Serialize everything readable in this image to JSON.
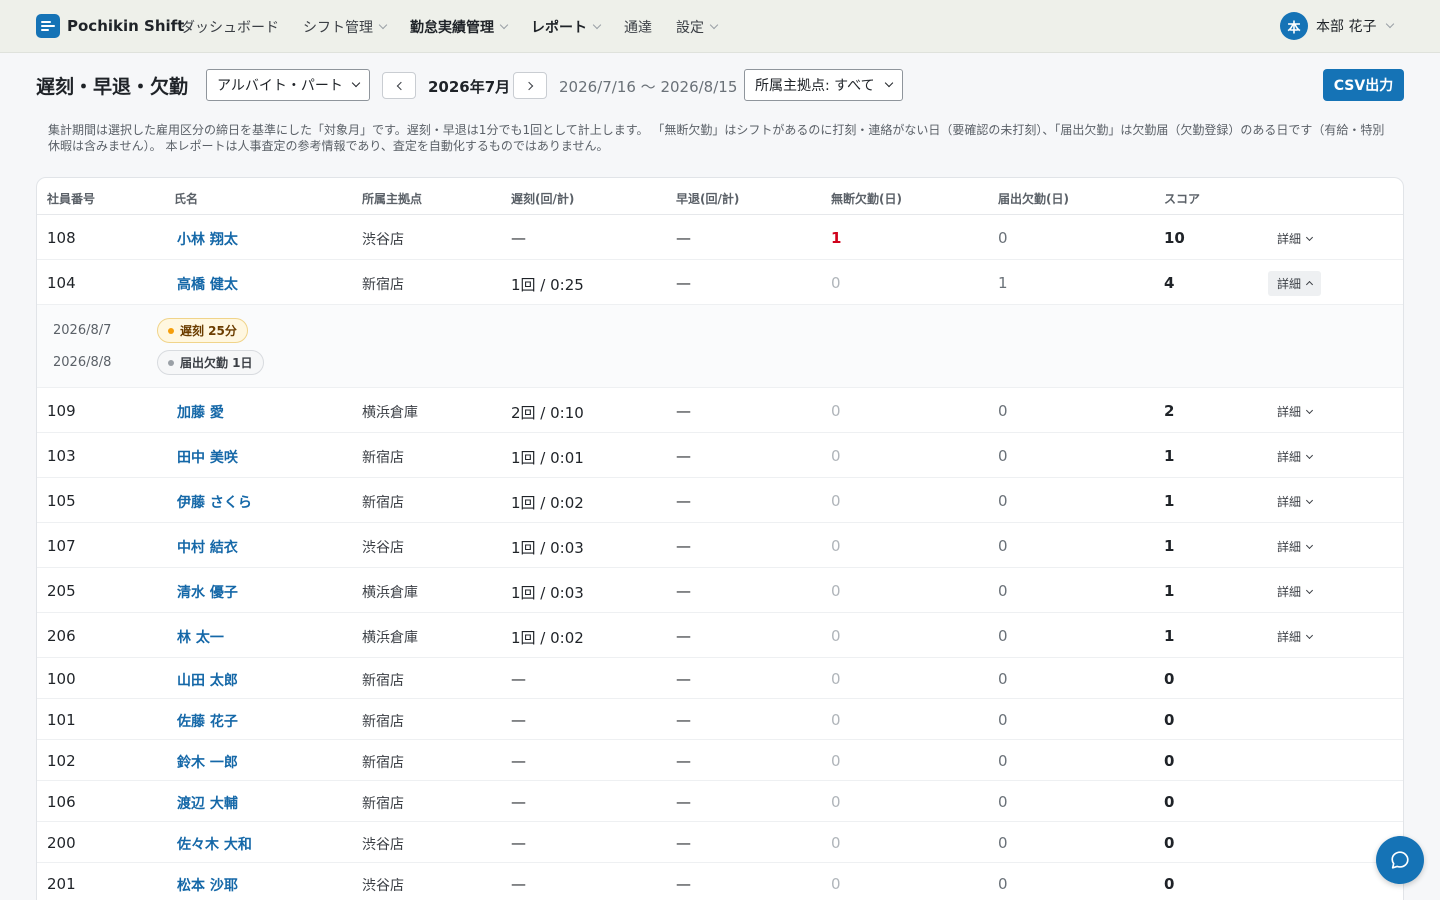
{
  "app": {
    "brand": "Pochikin Shift"
  },
  "nav": [
    {
      "label": "ダッシュボード",
      "dropdown": false,
      "bold": false
    },
    {
      "label": "シフト管理",
      "dropdown": true,
      "bold": false
    },
    {
      "label": "勤怠実績管理",
      "dropdown": true,
      "bold": true
    },
    {
      "label": "レポート",
      "dropdown": true,
      "bold": true
    },
    {
      "label": "通達",
      "dropdown": false,
      "bold": false
    },
    {
      "label": "設定",
      "dropdown": true,
      "bold": false
    }
  ],
  "user": {
    "initial": "本",
    "name": "本部 花子"
  },
  "page": {
    "title": "遅刻・早退・欠勤",
    "employment_type": "アルバイト・パート",
    "month": "2026年7月",
    "range": "2026/7/16 〜 2026/8/15",
    "base_filter": "所属主拠点: すべて",
    "csv_label": "CSV出力",
    "note": "集計期間は選択した雇用区分の締日を基準にした「対象月」です。遅刻・早退は1分でも1回として計上します。 「無断欠勤」はシフトがあるのに打刻・連絡がない日（要確認の未打刻）、「届出欠勤」は欠勤届（欠勤登録）のある日です（有給・特別休暇は含みません）。 本レポートは人事査定の参考情報であり、査定を自動化するものではありません。"
  },
  "table": {
    "headers": [
      "社員番号",
      "氏名",
      "所属主拠点",
      "遅刻(回/計)",
      "早退(回/計)",
      "無断欠勤(日)",
      "届出欠勤(日)",
      "スコア"
    ],
    "detail_label": "詳細",
    "rows": [
      {
        "id": "108",
        "name": "小林 翔太",
        "base": "渋谷店",
        "late": "—",
        "early": "—",
        "absent": "1",
        "notified": "0",
        "score": "10",
        "detail": true,
        "expanded": false,
        "alert": true
      },
      {
        "id": "104",
        "name": "高橋 健太",
        "base": "新宿店",
        "late": "1回 / 0:25",
        "early": "—",
        "absent": "0",
        "notified": "1",
        "score": "4",
        "detail": true,
        "expanded": true,
        "alert": false,
        "events": [
          {
            "date": "2026/8/7",
            "label": "遅刻 25分",
            "kind": "late"
          },
          {
            "date": "2026/8/8",
            "label": "届出欠勤 1日",
            "kind": "abs"
          }
        ]
      },
      {
        "id": "109",
        "name": "加藤 愛",
        "base": "横浜倉庫",
        "late": "2回 / 0:10",
        "early": "—",
        "absent": "0",
        "notified": "0",
        "score": "2",
        "detail": true,
        "expanded": false,
        "alert": false
      },
      {
        "id": "103",
        "name": "田中 美咲",
        "base": "新宿店",
        "late": "1回 / 0:01",
        "early": "—",
        "absent": "0",
        "notified": "0",
        "score": "1",
        "detail": true,
        "expanded": false,
        "alert": false
      },
      {
        "id": "105",
        "name": "伊藤 さくら",
        "base": "新宿店",
        "late": "1回 / 0:02",
        "early": "—",
        "absent": "0",
        "notified": "0",
        "score": "1",
        "detail": true,
        "expanded": false,
        "alert": false
      },
      {
        "id": "107",
        "name": "中村 結衣",
        "base": "渋谷店",
        "late": "1回 / 0:03",
        "early": "—",
        "absent": "0",
        "notified": "0",
        "score": "1",
        "detail": true,
        "expanded": false,
        "alert": false
      },
      {
        "id": "205",
        "name": "清水 優子",
        "base": "横浜倉庫",
        "late": "1回 / 0:03",
        "early": "—",
        "absent": "0",
        "notified": "0",
        "score": "1",
        "detail": true,
        "expanded": false,
        "alert": false
      },
      {
        "id": "206",
        "name": "林 太一",
        "base": "横浜倉庫",
        "late": "1回 / 0:02",
        "early": "—",
        "absent": "0",
        "notified": "0",
        "score": "1",
        "detail": true,
        "expanded": false,
        "alert": false
      },
      {
        "id": "100",
        "name": "山田 太郎",
        "base": "新宿店",
        "late": "—",
        "early": "—",
        "absent": "0",
        "notified": "0",
        "score": "0",
        "detail": false,
        "expanded": false,
        "alert": false
      },
      {
        "id": "101",
        "name": "佐藤 花子",
        "base": "新宿店",
        "late": "—",
        "early": "—",
        "absent": "0",
        "notified": "0",
        "score": "0",
        "detail": false,
        "expanded": false,
        "alert": false
      },
      {
        "id": "102",
        "name": "鈴木 一郎",
        "base": "新宿店",
        "late": "—",
        "early": "—",
        "absent": "0",
        "notified": "0",
        "score": "0",
        "detail": false,
        "expanded": false,
        "alert": false
      },
      {
        "id": "106",
        "name": "渡辺 大輔",
        "base": "新宿店",
        "late": "—",
        "early": "—",
        "absent": "0",
        "notified": "0",
        "score": "0",
        "detail": false,
        "expanded": false,
        "alert": false
      },
      {
        "id": "200",
        "name": "佐々木 大和",
        "base": "渋谷店",
        "late": "—",
        "early": "—",
        "absent": "0",
        "notified": "0",
        "score": "0",
        "detail": false,
        "expanded": false,
        "alert": false
      },
      {
        "id": "201",
        "name": "松本 沙耶",
        "base": "渋谷店",
        "late": "—",
        "early": "—",
        "absent": "0",
        "notified": "0",
        "score": "0",
        "detail": false,
        "expanded": false,
        "alert": false
      }
    ]
  }
}
